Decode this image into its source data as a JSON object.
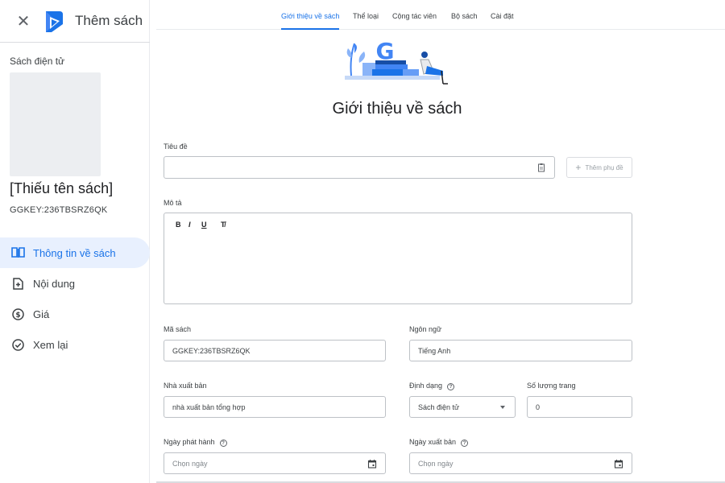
{
  "sidebar": {
    "title": "Thêm sách",
    "section_label": "Sách điện tử",
    "book_name": "[Thiếu tên sách]",
    "book_key": "GGKEY:236TBSRZ6QK",
    "items": [
      {
        "label": "Thông tin về sách",
        "icon": "book-info-icon",
        "active": true
      },
      {
        "label": "Nội dung",
        "icon": "add-file-icon",
        "active": false
      },
      {
        "label": "Giá",
        "icon": "dollar-icon",
        "active": false
      },
      {
        "label": "Xem lại",
        "icon": "check-circle-icon",
        "active": false
      }
    ]
  },
  "tabs": [
    {
      "label": "Giới thiệu về sách",
      "active": true
    },
    {
      "label": "Thể loại",
      "active": false
    },
    {
      "label": "Cộng tác viên",
      "active": false
    },
    {
      "label": "Bộ sách",
      "active": false
    },
    {
      "label": "Cài đặt",
      "active": false
    }
  ],
  "main": {
    "title": "Giới thiệu về sách",
    "title_field": {
      "label": "Tiêu đề",
      "value": ""
    },
    "add_subtitle": "Thêm phụ đề",
    "description": {
      "label": "Mô tả",
      "toolbar": [
        "B",
        "I",
        "U",
        "T̸"
      ]
    },
    "book_code": {
      "label": "Mã sách",
      "value": "GGKEY:236TBSRZ6QK"
    },
    "language": {
      "label": "Ngôn ngữ",
      "value": "Tiếng Anh"
    },
    "publisher": {
      "label": "Nhà xuất bản",
      "value": "nhà xuất bản tổng hợp"
    },
    "format": {
      "label": "Định dạng",
      "value": "Sách điện tử"
    },
    "page_count": {
      "label": "Số lượng trang",
      "value": "0"
    },
    "release_date": {
      "label": "Ngày phát hành",
      "placeholder": "Chọn ngày"
    },
    "publish_date": {
      "label": "Ngày xuất bản",
      "placeholder": "Chọn ngày"
    }
  },
  "colors": {
    "accent": "#1a73e8",
    "active_bg": "#e8f0fe"
  }
}
